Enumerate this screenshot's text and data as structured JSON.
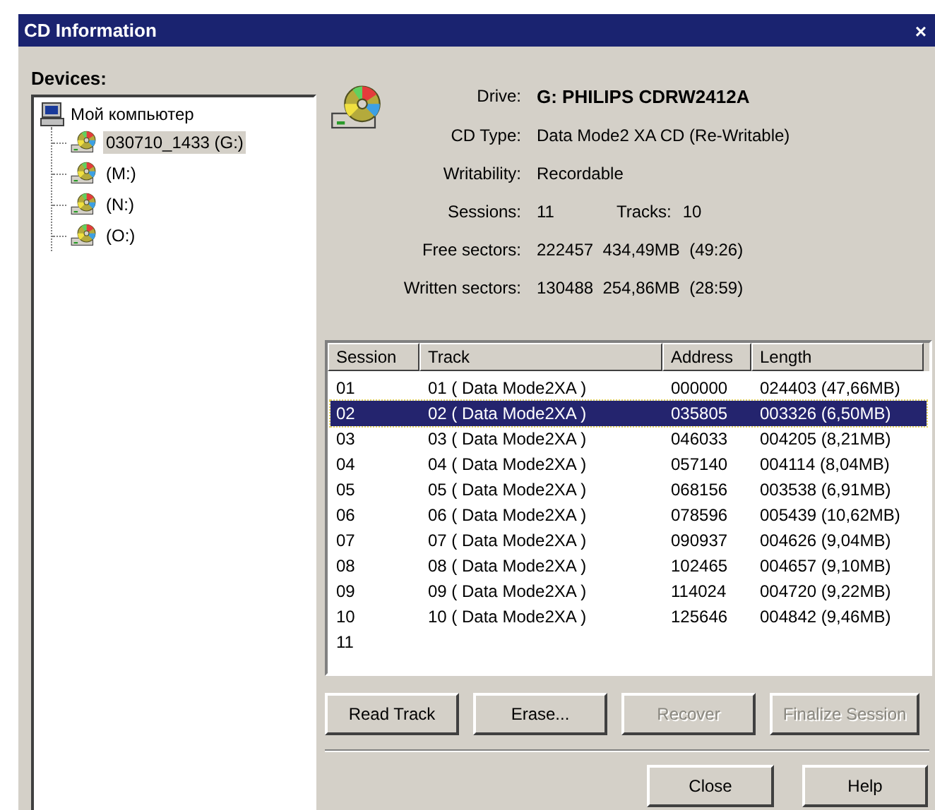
{
  "window": {
    "title": "CD Information",
    "close": "×"
  },
  "devices": {
    "label": "Devices:",
    "root": {
      "label": "Мой компьютер",
      "children": [
        {
          "label": "030710_1433 (G:)",
          "selected": true
        },
        {
          "label": "(M:)",
          "selected": false
        },
        {
          "label": "(N:)",
          "selected": false
        },
        {
          "label": "(O:)",
          "selected": false
        }
      ]
    }
  },
  "info": [
    {
      "label": "Drive:",
      "value": "G: PHILIPS CDRW2412A",
      "bold": true
    },
    {
      "label": "CD Type:",
      "value": "Data Mode2 XA CD (Re-Writable)",
      "bold": false
    },
    {
      "label": "Writability:",
      "value": "Recordable",
      "bold": false
    },
    {
      "label": "Sessions:",
      "value": "11",
      "bold": false,
      "extra_label": "Tracks:",
      "extra_value": "10"
    },
    {
      "label": "Free sectors:",
      "value": "222457  434,49MB  (49:26)",
      "bold": false
    },
    {
      "label": "Written sectors:",
      "value": "130488  254,86MB  (28:59)",
      "bold": false
    }
  ],
  "table": {
    "columns": [
      "Session",
      "Track",
      "Address",
      "Length"
    ],
    "rows": [
      {
        "cells": [
          "01",
          "01 ( Data Mode2XA )",
          "000000",
          "024403 (47,66MB)"
        ],
        "selected": false
      },
      {
        "cells": [
          "02",
          "02 ( Data Mode2XA )",
          "035805",
          "003326 (6,50MB)"
        ],
        "selected": true
      },
      {
        "cells": [
          "03",
          "03 ( Data Mode2XA )",
          "046033",
          "004205 (8,21MB)"
        ],
        "selected": false
      },
      {
        "cells": [
          "04",
          "04 ( Data Mode2XA )",
          "057140",
          "004114 (8,04MB)"
        ],
        "selected": false
      },
      {
        "cells": [
          "05",
          "05 ( Data Mode2XA )",
          "068156",
          "003538 (6,91MB)"
        ],
        "selected": false
      },
      {
        "cells": [
          "06",
          "06 ( Data Mode2XA )",
          "078596",
          "005439 (10,62MB)"
        ],
        "selected": false
      },
      {
        "cells": [
          "07",
          "07 ( Data Mode2XA )",
          "090937",
          "004626 (9,04MB)"
        ],
        "selected": false
      },
      {
        "cells": [
          "08",
          "08 ( Data Mode2XA )",
          "102465",
          "004657 (9,10MB)"
        ],
        "selected": false
      },
      {
        "cells": [
          "09",
          "09 ( Data Mode2XA )",
          "114024",
          "004720 (9,22MB)"
        ],
        "selected": false
      },
      {
        "cells": [
          "10",
          "10 ( Data Mode2XA )",
          "125646",
          "004842 (9,46MB)"
        ],
        "selected": false
      },
      {
        "cells": [
          "11"
        ],
        "selected": false
      }
    ]
  },
  "actions": [
    {
      "label": "Read Track",
      "disabled": false
    },
    {
      "label": "Erase...",
      "disabled": false
    },
    {
      "label": "Recover",
      "disabled": true
    },
    {
      "label": "Finalize Session",
      "disabled": true
    }
  ],
  "buttons": [
    "Close",
    "Help"
  ]
}
